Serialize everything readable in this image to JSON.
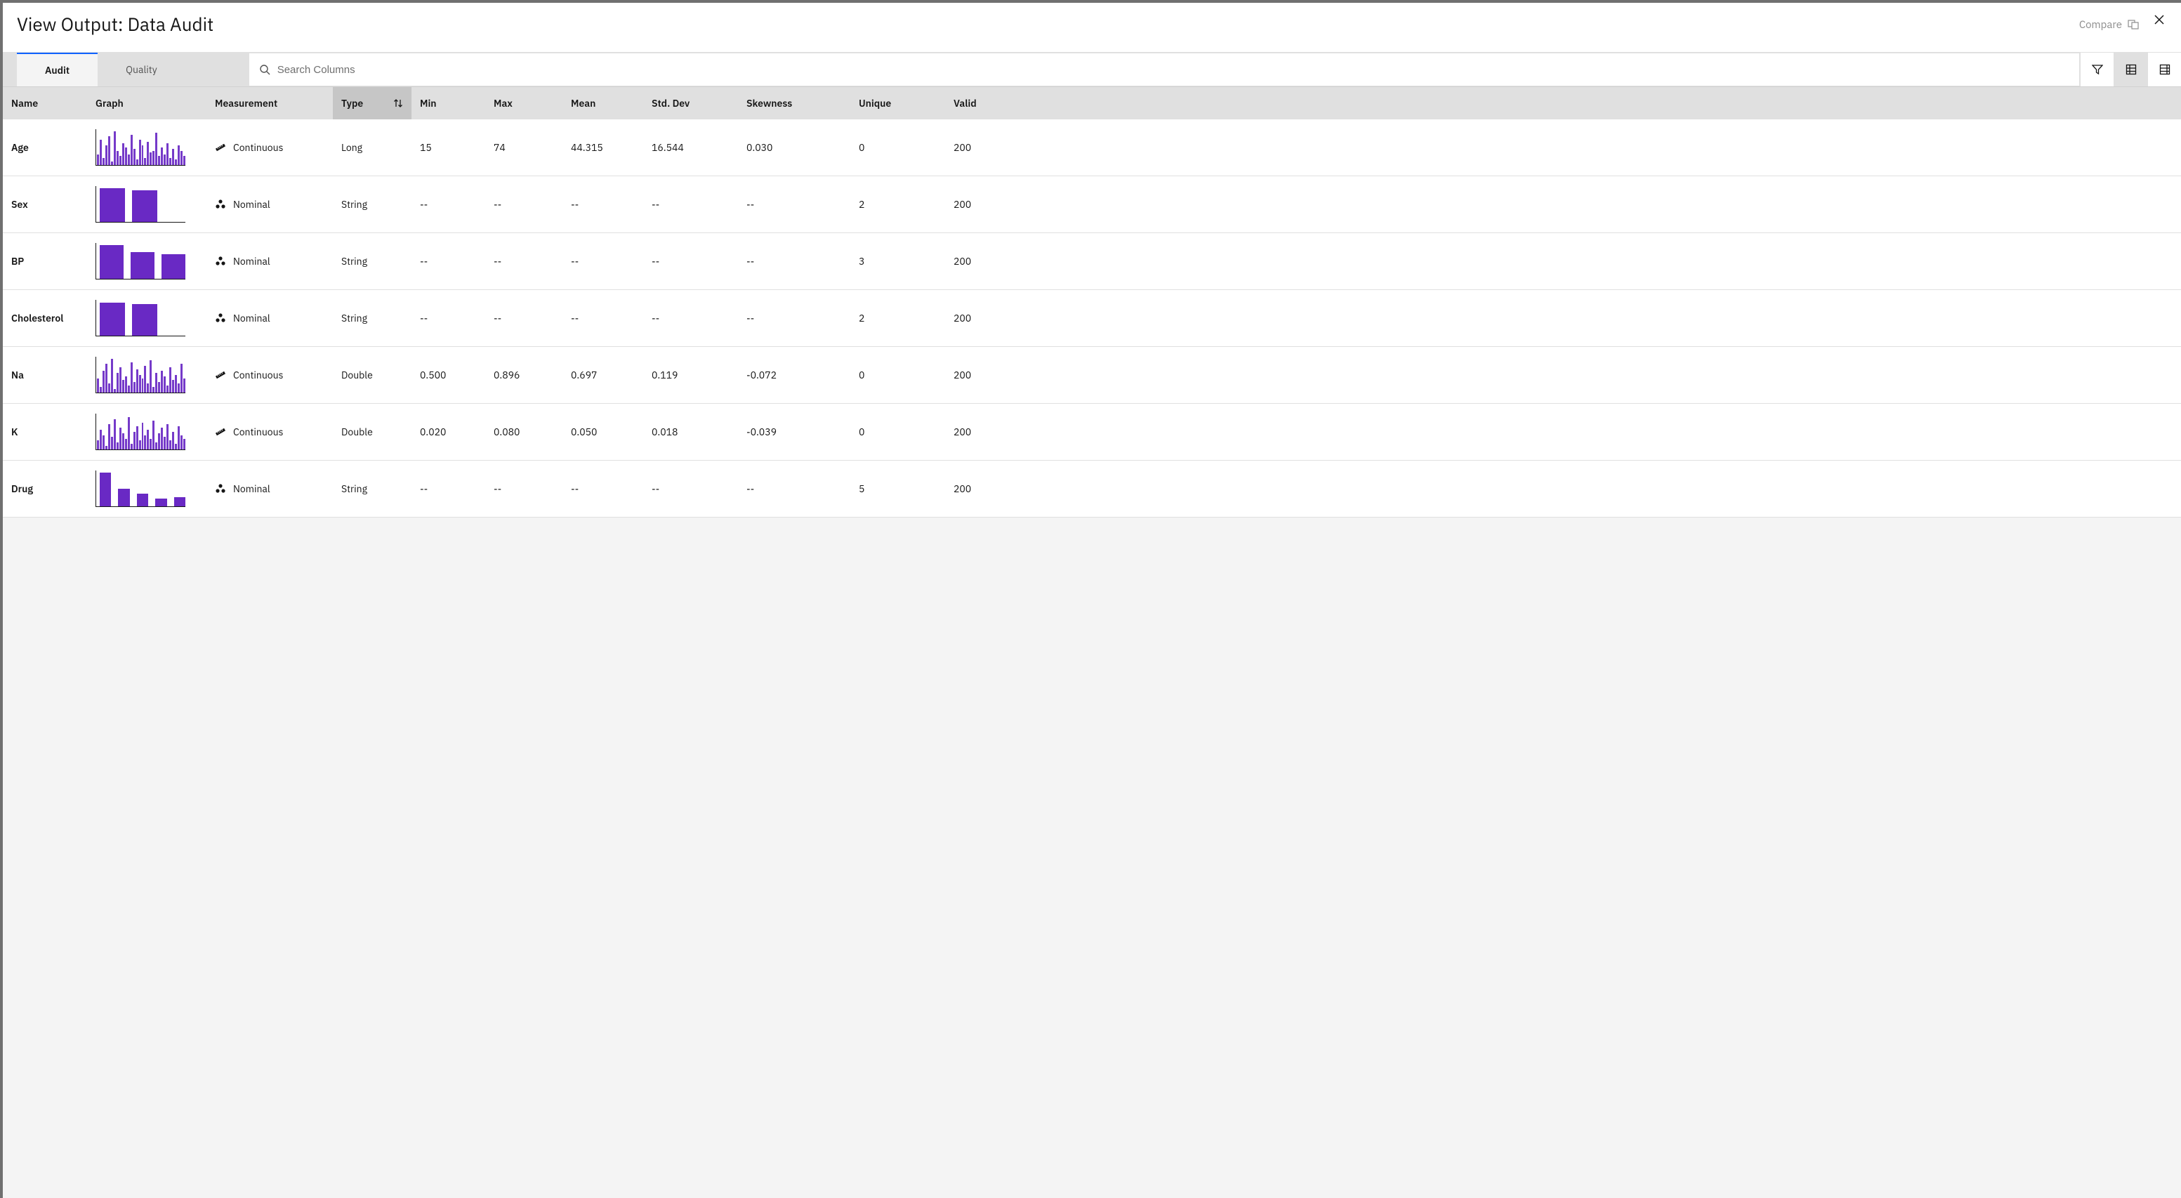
{
  "header": {
    "title": "View Output: Data Audit",
    "compare_label": "Compare"
  },
  "tabs": {
    "audit": "Audit",
    "quality": "Quality"
  },
  "search": {
    "placeholder": "Search Columns"
  },
  "columns": {
    "name": "Name",
    "graph": "Graph",
    "measurement": "Measurement",
    "type": "Type",
    "min": "Min",
    "max": "Max",
    "mean": "Mean",
    "stddev": "Std. Dev",
    "skewness": "Skewness",
    "unique": "Unique",
    "valid": "Valid"
  },
  "rows": [
    {
      "name": "Age",
      "measurement": "Continuous",
      "type": "Long",
      "min": "15",
      "max": "74",
      "mean": "44.315",
      "stddev": "16.544",
      "skewness": "0.030",
      "unique": "0",
      "valid": "200",
      "graph_type": "dense",
      "bars": [
        30,
        70,
        20,
        55,
        80,
        10,
        95,
        40,
        25,
        60,
        50,
        30,
        85,
        45,
        15,
        70,
        55,
        20,
        65,
        35,
        40,
        90,
        25,
        50,
        30,
        60,
        20,
        45,
        15,
        55,
        40,
        25
      ]
    },
    {
      "name": "Sex",
      "measurement": "Nominal",
      "type": "String",
      "min": "--",
      "max": "--",
      "mean": "--",
      "stddev": "--",
      "skewness": "--",
      "unique": "2",
      "valid": "200",
      "graph_type": "wide",
      "wide_bars": [
        95,
        88
      ]
    },
    {
      "name": "BP",
      "measurement": "Nominal",
      "type": "String",
      "min": "--",
      "max": "--",
      "mean": "--",
      "stddev": "--",
      "skewness": "--",
      "unique": "3",
      "valid": "200",
      "graph_type": "wide",
      "wide_bars": [
        95,
        75,
        68
      ]
    },
    {
      "name": "Cholesterol",
      "measurement": "Nominal",
      "type": "String",
      "min": "--",
      "max": "--",
      "mean": "--",
      "stddev": "--",
      "skewness": "--",
      "unique": "2",
      "valid": "200",
      "graph_type": "wide",
      "wide_bars": [
        92,
        88
      ]
    },
    {
      "name": "Na",
      "measurement": "Continuous",
      "type": "Double",
      "min": "0.500",
      "max": "0.896",
      "mean": "0.697",
      "stddev": "0.119",
      "skewness": "-0.072",
      "unique": "0",
      "valid": "200",
      "graph_type": "dense",
      "bars": [
        40,
        15,
        60,
        80,
        25,
        95,
        10,
        55,
        70,
        35,
        45,
        20,
        85,
        30,
        65,
        50,
        40,
        75,
        25,
        90,
        15,
        55,
        30,
        60,
        45,
        20,
        70,
        35,
        50,
        25,
        80,
        40
      ]
    },
    {
      "name": "K",
      "measurement": "Continuous",
      "type": "Double",
      "min": "0.020",
      "max": "0.080",
      "mean": "0.050",
      "stddev": "0.018",
      "skewness": "-0.039",
      "unique": "0",
      "valid": "200",
      "graph_type": "dense",
      "bars": [
        25,
        55,
        40,
        10,
        70,
        35,
        85,
        20,
        60,
        45,
        30,
        90,
        15,
        50,
        65,
        25,
        75,
        40,
        55,
        30,
        80,
        20,
        45,
        60,
        35,
        70,
        25,
        50,
        15,
        65,
        40,
        30
      ]
    },
    {
      "name": "Drug",
      "measurement": "Nominal",
      "type": "String",
      "min": "--",
      "max": "--",
      "mean": "--",
      "stddev": "--",
      "skewness": "--",
      "unique": "5",
      "valid": "200",
      "graph_type": "wide",
      "wide_bars": [
        95,
        50,
        35,
        22,
        25
      ]
    }
  ],
  "chart_data": [
    {
      "type": "bar",
      "field": "Age",
      "title": "Age distribution",
      "values": [
        30,
        70,
        20,
        55,
        80,
        10,
        95,
        40,
        25,
        60,
        50,
        30,
        85,
        45,
        15,
        70,
        55,
        20,
        65,
        35,
        40,
        90,
        25,
        50,
        30,
        60,
        20,
        45,
        15,
        55,
        40,
        25
      ]
    },
    {
      "type": "bar",
      "field": "Sex",
      "title": "Sex counts",
      "values": [
        95,
        88
      ]
    },
    {
      "type": "bar",
      "field": "BP",
      "title": "BP counts",
      "values": [
        95,
        75,
        68
      ]
    },
    {
      "type": "bar",
      "field": "Cholesterol",
      "title": "Cholesterol counts",
      "values": [
        92,
        88
      ]
    },
    {
      "type": "bar",
      "field": "Na",
      "title": "Na distribution",
      "values": [
        40,
        15,
        60,
        80,
        25,
        95,
        10,
        55,
        70,
        35,
        45,
        20,
        85,
        30,
        65,
        50,
        40,
        75,
        25,
        90,
        15,
        55,
        30,
        60,
        45,
        20,
        70,
        35,
        50,
        25,
        80,
        40
      ]
    },
    {
      "type": "bar",
      "field": "K",
      "title": "K distribution",
      "values": [
        25,
        55,
        40,
        10,
        70,
        35,
        85,
        20,
        60,
        45,
        30,
        90,
        15,
        50,
        65,
        25,
        75,
        40,
        55,
        30,
        80,
        20,
        45,
        60,
        35,
        70,
        25,
        50,
        15,
        65,
        40,
        30
      ]
    },
    {
      "type": "bar",
      "field": "Drug",
      "title": "Drug counts",
      "values": [
        95,
        50,
        35,
        22,
        25
      ]
    }
  ]
}
